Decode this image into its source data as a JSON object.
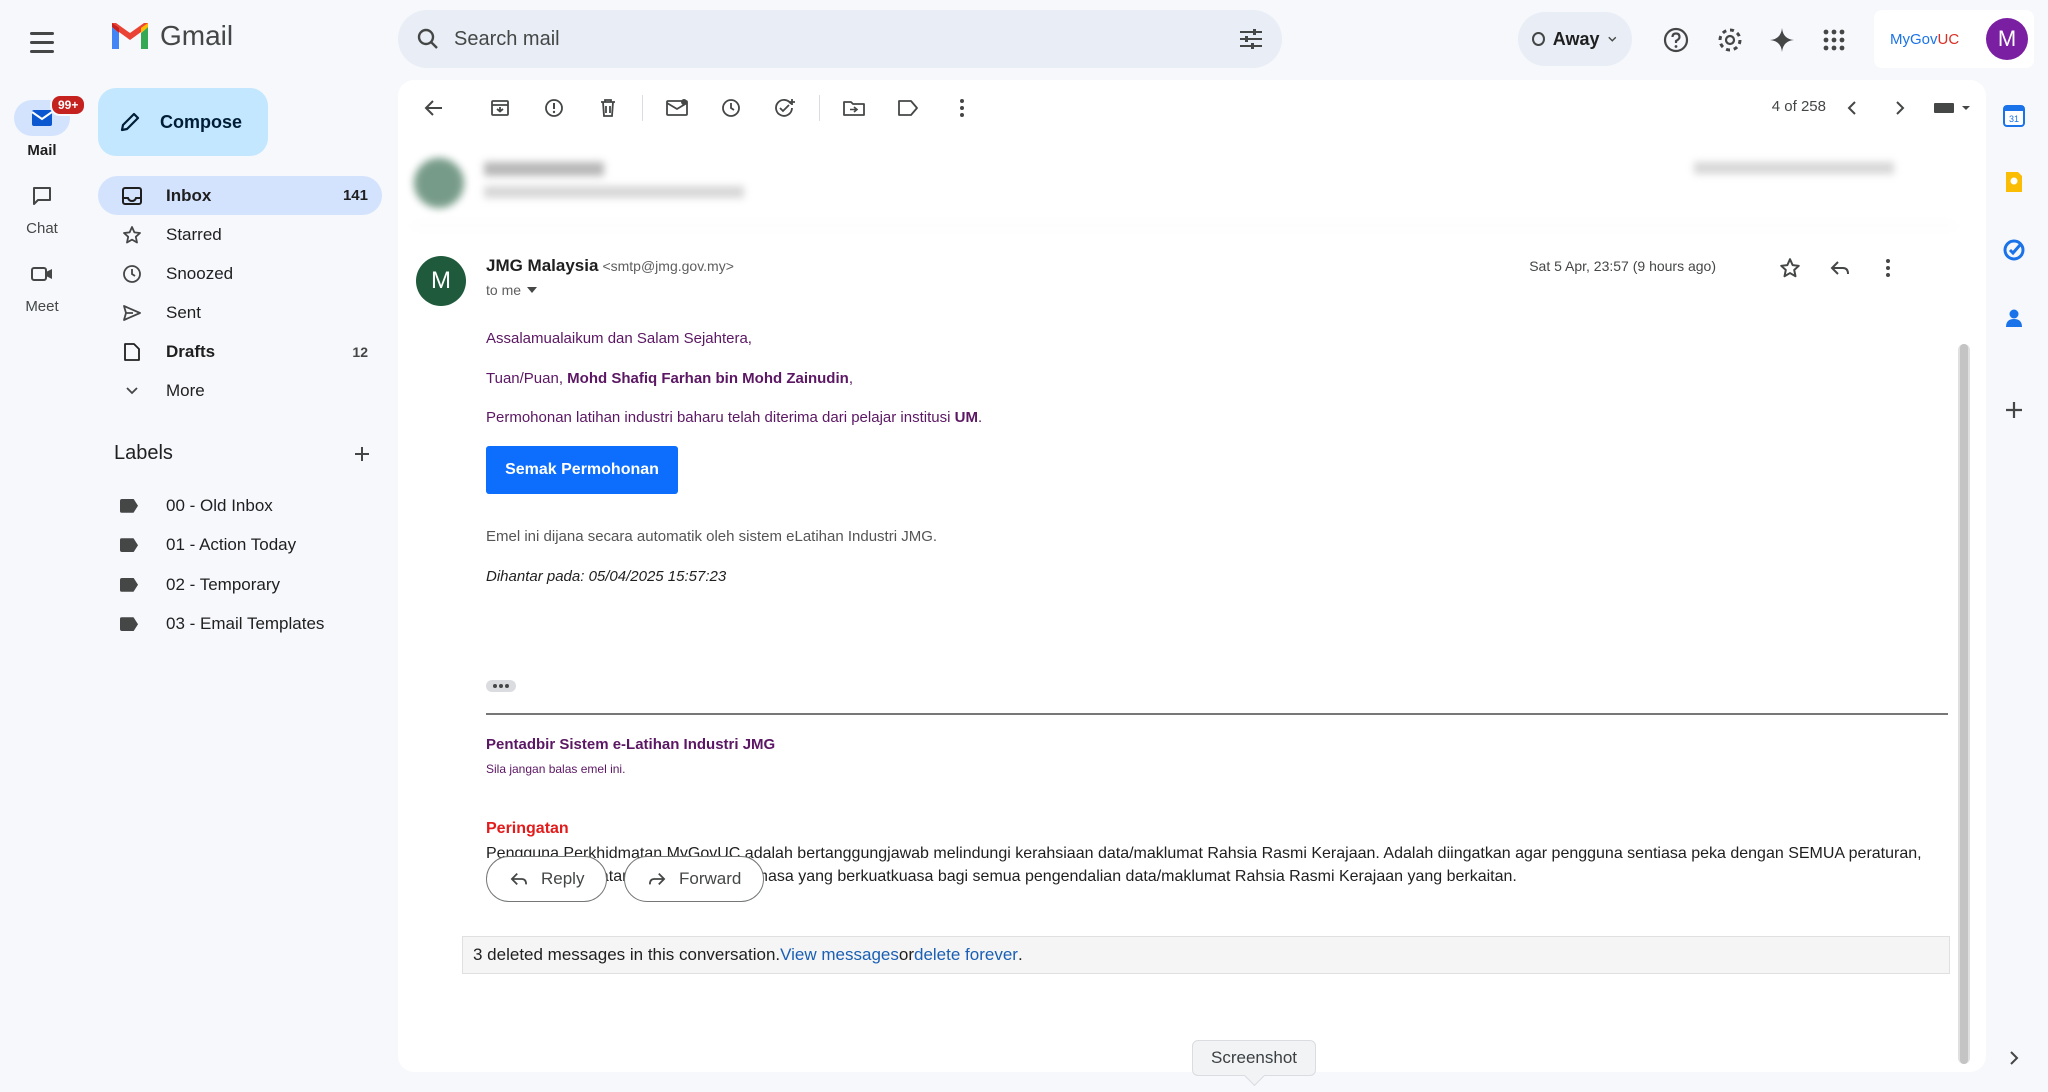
{
  "rail": {
    "items": [
      {
        "label": "Mail",
        "badge": "99+"
      },
      {
        "label": "Chat"
      },
      {
        "label": "Meet"
      }
    ]
  },
  "app": {
    "name": "Gmail"
  },
  "search": {
    "placeholder": "Search mail"
  },
  "header": {
    "status": "Away",
    "account_org": "MyGov",
    "account_org_suffix": "UC",
    "avatar_letter": "M"
  },
  "sidebar": {
    "compose_label": "Compose",
    "items": [
      {
        "label": "Inbox",
        "count": "141"
      },
      {
        "label": "Starred",
        "count": ""
      },
      {
        "label": "Snoozed",
        "count": ""
      },
      {
        "label": "Sent",
        "count": ""
      },
      {
        "label": "Drafts",
        "count": "12"
      },
      {
        "label": "More",
        "count": ""
      }
    ],
    "labels_title": "Labels",
    "labels": [
      {
        "label": "00 - Old Inbox"
      },
      {
        "label": "01 - Action Today"
      },
      {
        "label": "02 - Temporary"
      },
      {
        "label": "03 - Email Templates"
      }
    ]
  },
  "toolbar": {
    "pager": "4 of 258"
  },
  "message": {
    "sender_initial": "M",
    "sender_name": "JMG Malaysia",
    "sender_email": "<smtp@jmg.gov.my>",
    "to": "to me",
    "date": "Sat 5 Apr, 23:57 (9 hours ago)",
    "greeting": "Assalamualaikum dan Salam Sejahtera,",
    "salutation_prefix": "Tuan/Puan, ",
    "recipient_name": "Mohd Shafiq Farhan bin Mohd Zainudin",
    "salutation_suffix": ",",
    "body_prefix": "Permohonan latihan industri baharu telah diterima dari pelajar institusi ",
    "institution": "UM",
    "body_suffix": ".",
    "cta_label": "Semak Permohonan",
    "auto_note": "Emel ini dijana secara automatik oleh sistem eLatihan Industri JMG.",
    "sent_at": "Dihantar pada: 05/04/2025 15:57:23",
    "signature_title": "Pentadbir Sistem e-Latihan Industri JMG",
    "signature_note": "Sila jangan balas emel ini.",
    "warning_title": "Peringatan",
    "warning_text": "Pengguna Perkhidmatan MyGovUC adalah bertanggungjawab melindungi kerahsiaan data/maklumat Rahsia Rasmi Kerajaan. Adalah diingatkan agar pengguna sentiasa peka dengan SEMUA peraturan, arahan keselamatan dan pekeliling semasa yang berkuatkuasa bagi semua pengendalian data/maklumat Rahsia Rasmi Kerajaan yang berkaitan."
  },
  "actions": {
    "reply": "Reply",
    "forward": "Forward"
  },
  "deleted": {
    "prefix": "3 deleted messages in this conversation. ",
    "view_link": "View messages",
    "or": " or ",
    "delete_link": "delete forever",
    "suffix": "."
  },
  "tooltip": "Screenshot",
  "colors": {
    "accent": "#0d6efd",
    "purple_text": "#5b1763",
    "warning": "#e31b1b",
    "avatar": "#1e5a3b"
  }
}
